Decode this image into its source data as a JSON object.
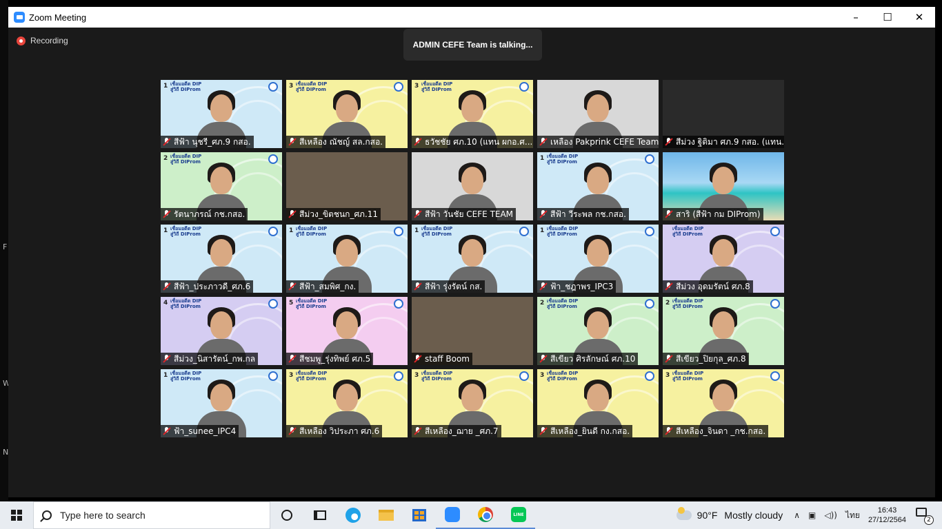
{
  "window": {
    "title": "Zoom Meeting",
    "controls": {
      "minimize": "–",
      "maximize": "☐",
      "close": "✕"
    }
  },
  "recording_label": "Recording",
  "talking_banner": "ADMIN CEFE Team is talking...",
  "participants": [
    {
      "name": "สีฟ้า นุชรี_ศภ.9 กสอ.",
      "color": "blue",
      "badge": "1"
    },
    {
      "name": "สีเหลือง ณัชญ์ สล.กสอ.",
      "color": "yellow",
      "badge": "3"
    },
    {
      "name": "ธวัชชัย ศภ.10 (แทน ผกอ.ศ...",
      "color": "yellow",
      "badge": "3"
    },
    {
      "name": "เหลือง Pakprink CEFE Team",
      "color": "gray",
      "badge": ""
    },
    {
      "name": "สีม่วง ฐิติมา ศภ.9 กสอ. (แทน...",
      "color": "dark",
      "badge": ""
    },
    {
      "name": "รัตนาภรณ์ กช.กสอ.",
      "color": "green",
      "badge": "2"
    },
    {
      "name": "สีม่วง_ขิตชนก_ศภ.11",
      "color": "room",
      "badge": ""
    },
    {
      "name": "สีฟ้า วันชัย CEFE TEAM",
      "color": "gray",
      "badge": ""
    },
    {
      "name": "สีฟ้า วีระพล กช.กสอ.",
      "color": "blue",
      "badge": "1"
    },
    {
      "name": "สาริ (สีฟ้า กม DIProm)",
      "color": "beach",
      "badge": ""
    },
    {
      "name": "สีฟ้า_ประภาวดี_ศภ.6",
      "color": "blue",
      "badge": "1"
    },
    {
      "name": "สีฟ้า_สมพิศ_กง.",
      "color": "blue",
      "badge": "1"
    },
    {
      "name": "สีฟ้า รุ่งรัตน์ กส.",
      "color": "blue",
      "badge": "1"
    },
    {
      "name": "ฟ้า_ชฎาพร_IPC3",
      "color": "blue",
      "badge": "1"
    },
    {
      "name": "สีม่วง อุดมรัตน์ ศภ.8",
      "color": "purple",
      "badge": ""
    },
    {
      "name": "สีม่วง_นิสารัตน์_กพ.กล",
      "color": "purple",
      "badge": "4"
    },
    {
      "name": "สีชมพู_รุ่งทิพย์ ศภ.5",
      "color": "pink",
      "badge": "5"
    },
    {
      "name": "staff Boom",
      "color": "room",
      "badge": ""
    },
    {
      "name": "สีเขียว ศิรลักษณ์ ศภ.10",
      "color": "green",
      "badge": "2"
    },
    {
      "name": "สีเขียว_ปิยกุล_ศภ.8",
      "color": "green",
      "badge": "2"
    },
    {
      "name": "ฟ้า_sunee_IPC4",
      "color": "blue",
      "badge": "1"
    },
    {
      "name": "สีเหลือง วิประภา ศภ.6",
      "color": "yellow",
      "badge": "3"
    },
    {
      "name": "สีเหลือง_ฌาย _ศภ.7",
      "color": "yellow",
      "badge": "3"
    },
    {
      "name": "สีเหลือง_ยินดี กง.กสอ.",
      "color": "yellow",
      "badge": "3"
    },
    {
      "name": "สีเหลือง_จินดา _กช.กสอ.",
      "color": "yellow",
      "badge": "3"
    }
  ],
  "banner": {
    "line1": "เชื่อมอดีต DIP",
    "line2": "สู่วิถี DIProm"
  },
  "taskbar": {
    "search_placeholder": "Type here to search",
    "weather_temp": "90°F",
    "weather_text": "Mostly cloudy",
    "language": "ไทย",
    "time": "16:43",
    "date": "27/12/2564",
    "notifications": "2",
    "line_label": "LINE"
  }
}
